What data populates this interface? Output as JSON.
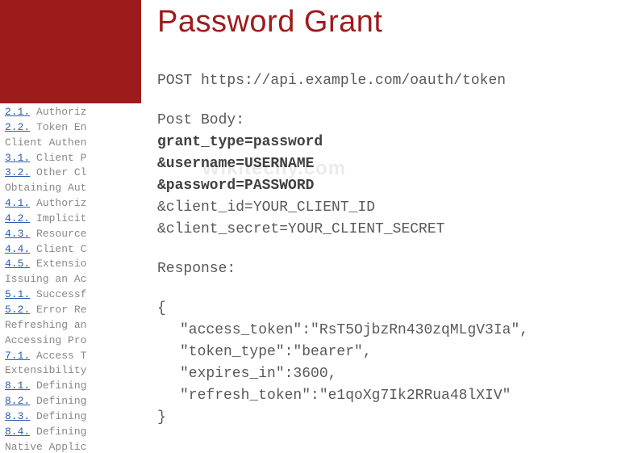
{
  "title": "Password Grant",
  "watermark": "Wikitechy.com",
  "toc": [
    {
      "num": "2.1.",
      "text": "  Authoriz",
      "is_heading": false
    },
    {
      "num": "2.2.",
      "text": "  Token En",
      "is_heading": false
    },
    {
      "num": "",
      "text": " Client Authen",
      "is_heading": true
    },
    {
      "num": "3.1.",
      "text": "  Client P",
      "is_heading": false
    },
    {
      "num": "3.2.",
      "text": "  Other Cl",
      "is_heading": false
    },
    {
      "num": "",
      "text": " Obtaining Aut",
      "is_heading": true
    },
    {
      "num": "4.1.",
      "text": "  Authoriz",
      "is_heading": false
    },
    {
      "num": "4.2.",
      "text": "  Implicit",
      "is_heading": false
    },
    {
      "num": "4.3.",
      "text": "  Resource",
      "is_heading": false
    },
    {
      "num": "4.4.",
      "text": "  Client C",
      "is_heading": false
    },
    {
      "num": "4.5.",
      "text": "  Extensio",
      "is_heading": false
    },
    {
      "num": "",
      "text": " Issuing an Ac",
      "is_heading": true
    },
    {
      "num": "5.1.",
      "text": "  Successf",
      "is_heading": false
    },
    {
      "num": "5.2.",
      "text": "  Error Re",
      "is_heading": false
    },
    {
      "num": "",
      "text": " Refreshing an",
      "is_heading": true
    },
    {
      "num": "",
      "text": " Accessing Pro",
      "is_heading": true
    },
    {
      "num": "7.1.",
      "text": "  Access T",
      "is_heading": false
    },
    {
      "num": "",
      "text": " Extensibility",
      "is_heading": true
    },
    {
      "num": "8.1.",
      "text": "  Defining",
      "is_heading": false
    },
    {
      "num": "8.2.",
      "text": "  Defining",
      "is_heading": false
    },
    {
      "num": "8.3.",
      "text": "  Defining",
      "is_heading": false
    },
    {
      "num": "8.4.",
      "text": "  Defining",
      "is_heading": false
    },
    {
      "num": "",
      "text": " Native Applic",
      "is_heading": true
    }
  ],
  "request_line": "POST https://api.example.com/oauth/token",
  "post_body_label": "Post Body:",
  "post_body": [
    {
      "text": "grant_type=password",
      "bold": true
    },
    {
      "text": "&username=USERNAME",
      "bold": true
    },
    {
      "text": "&password=PASSWORD",
      "bold": true
    },
    {
      "text": "&client_id=YOUR_CLIENT_ID",
      "bold": false
    },
    {
      "text": "&client_secret=YOUR_CLIENT_SECRET",
      "bold": false
    }
  ],
  "response_label": "Response:",
  "response_open": "{",
  "response_lines": [
    "\"access_token\":\"RsT5OjbzRn430zqMLgV3Ia\",",
    "\"token_type\":\"bearer\",",
    "\"expires_in\":3600,",
    "\"refresh_token\":\"e1qoXg7Ik2RRua48lXIV\""
  ],
  "response_close": "}"
}
